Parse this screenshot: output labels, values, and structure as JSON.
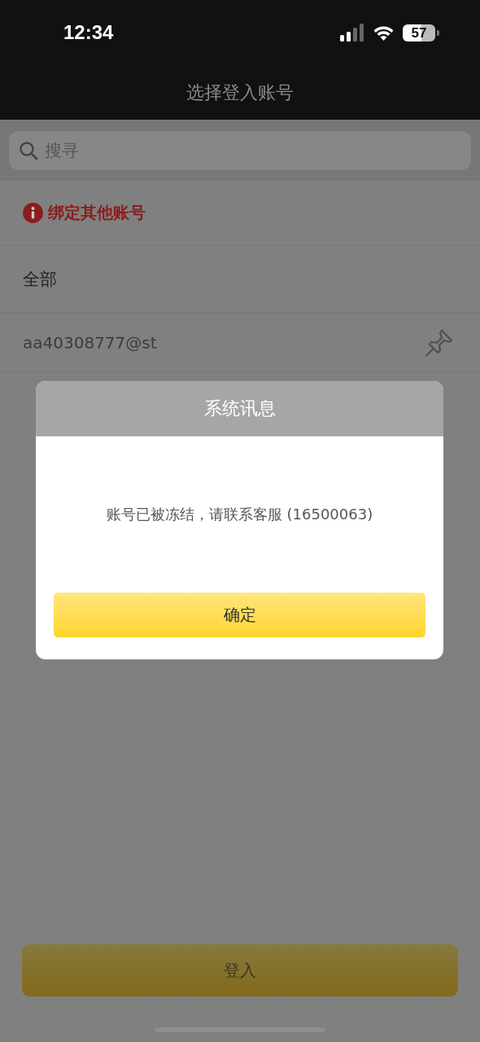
{
  "status_bar": {
    "time": "12:34",
    "battery": "57"
  },
  "nav_bar": {
    "title": "选择登入账号"
  },
  "search": {
    "placeholder": "搜寻"
  },
  "bind_link": {
    "label": "绑定其他账号"
  },
  "rows": [
    {
      "kind": "header",
      "label": "全部"
    },
    {
      "kind": "account",
      "label": "aa40308777@st"
    }
  ],
  "dialog": {
    "title": "系统讯息",
    "message": "账号已被冻结，请联系客服 (16500063)",
    "buttons": [
      "确定"
    ]
  },
  "login_button": {
    "label": "登入"
  }
}
